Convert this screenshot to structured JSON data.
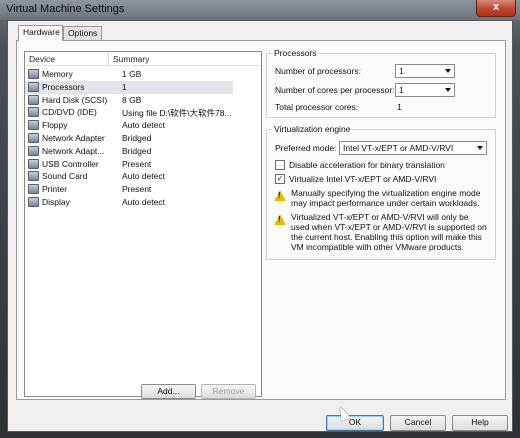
{
  "window": {
    "title": "Virtual Machine Settings",
    "close_glyph": "x"
  },
  "tabs": [
    {
      "label": "Hardware"
    },
    {
      "label": "Options"
    }
  ],
  "device_list": {
    "columns": {
      "device": "Device",
      "summary": "Summary"
    },
    "rows": [
      {
        "device": "Memory",
        "summary": "1 GB",
        "icon": "memory-icon"
      },
      {
        "device": "Processors",
        "summary": "1",
        "icon": "processor-icon"
      },
      {
        "device": "Hard Disk (SCSI)",
        "summary": "8 GB",
        "icon": "hard-disk-icon"
      },
      {
        "device": "CD/DVD (IDE)",
        "summary": "Using file D:\\软件\\大软件78...",
        "icon": "cd-dvd-icon"
      },
      {
        "device": "Floppy",
        "summary": "Auto detect",
        "icon": "floppy-icon"
      },
      {
        "device": "Network Adapter",
        "summary": "Bridged",
        "icon": "network-adapter-icon"
      },
      {
        "device": "Network Adapt...",
        "summary": "Bridged",
        "icon": "network-adapter-icon"
      },
      {
        "device": "USB Controller",
        "summary": "Present",
        "icon": "usb-controller-icon"
      },
      {
        "device": "Sound Card",
        "summary": "Auto detect",
        "icon": "sound-card-icon"
      },
      {
        "device": "Printer",
        "summary": "Present",
        "icon": "printer-icon"
      },
      {
        "device": "Display",
        "summary": "Auto detect",
        "icon": "display-icon"
      }
    ],
    "selected_index": 1
  },
  "list_buttons": {
    "add": "Add...",
    "remove": "Remove"
  },
  "processors": {
    "title": "Processors",
    "num_processors_label": "Number of processors:",
    "num_processors_value": "1",
    "cores_label": "Number of cores per processor:",
    "cores_value": "1",
    "total_label": "Total processor cores:",
    "total_value": "1"
  },
  "virtualization": {
    "title": "Virtualization engine",
    "preferred_label": "Preferred mode:",
    "preferred_value": "Intel VT-x/EPT or AMD-V/RVI",
    "disable_accel_label": "Disable acceleration for binary translation",
    "disable_accel_checked": false,
    "virtualize_label": "Virtualize Intel VT-x/EPT or AMD-V/RVI",
    "virtualize_checked": true,
    "warning1": "Manually specifying the virtualization engine mode may impact performance under certain workloads.",
    "warning2": "Virtualized VT-x/EPT or AMD-V/RVI will only be used when VT-x/EPT or AMD-V/RVI is supported on the current host. Enabling this option will make this VM incompatible with other VMware products."
  },
  "footer": {
    "ok": "OK",
    "cancel": "Cancel",
    "help": "Help"
  },
  "colors": {
    "accent": "#3c7fb1",
    "warning": "#e8b712",
    "close": "#c0442f"
  }
}
